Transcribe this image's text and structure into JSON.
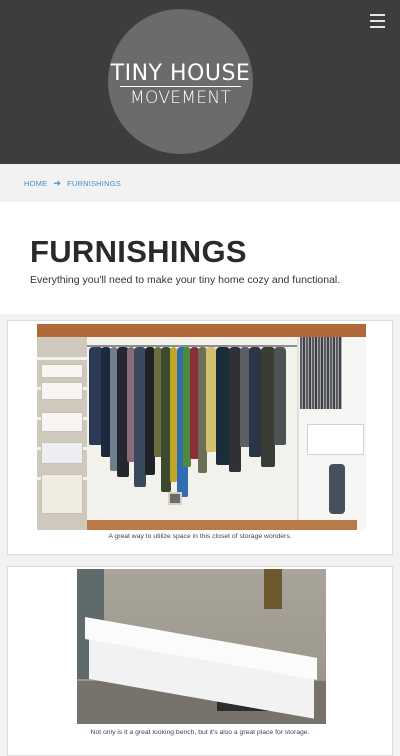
{
  "header": {
    "logo_line1": "TINY HOUSE",
    "logo_line2": "MOVEMENT",
    "menu_icon": "hamburger-menu-icon",
    "background": "#3d3d3d"
  },
  "breadcrumb": {
    "home": "HOME",
    "separator_icon": "right-arrow-icon",
    "current": "FURNISHINGS",
    "color": "#3b8fd1"
  },
  "page": {
    "title": "FURNISHINGS",
    "subtitle": "Everything you'll need to make your tiny home cozy and functional."
  },
  "cards": [
    {
      "image": "closet-photo",
      "caption": "A great way to utilize space in this closet of storage wonders."
    },
    {
      "image": "bench-photo",
      "caption": "Not only is it a great looking bench, but it's also a great place for storage."
    }
  ]
}
